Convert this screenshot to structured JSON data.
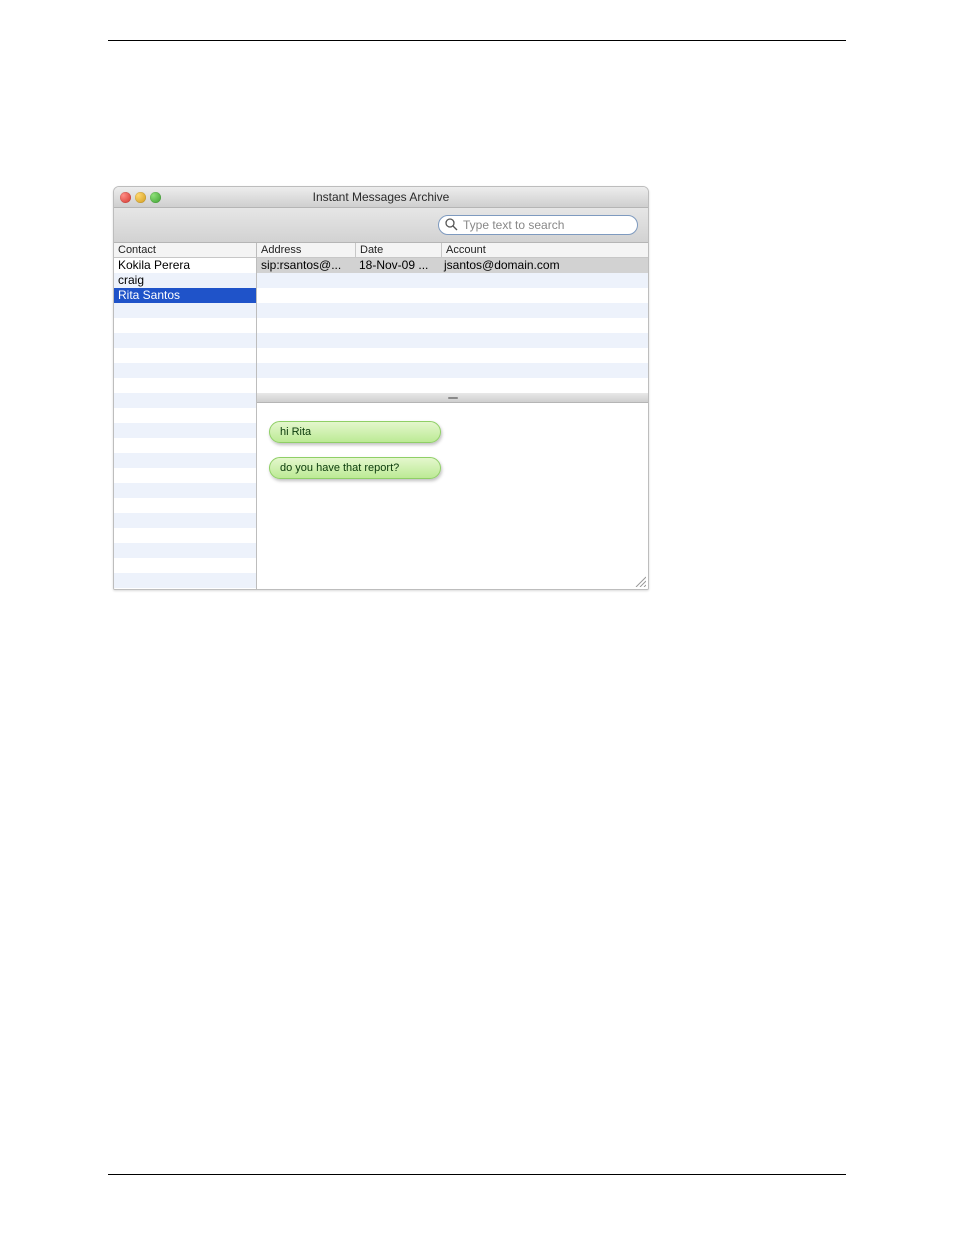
{
  "window": {
    "title": "Instant Messages Archive"
  },
  "search": {
    "placeholder": "Type text to search"
  },
  "contacts": {
    "header": "Contact",
    "items": [
      {
        "name": "Kokila Perera",
        "selected": false
      },
      {
        "name": "craig",
        "selected": false
      },
      {
        "name": "Rita Santos",
        "selected": true
      }
    ]
  },
  "sessions": {
    "headers": {
      "address": "Address",
      "date": "Date",
      "account": "Account"
    },
    "rows": [
      {
        "address": "sip:rsantos@...",
        "date": "18-Nov-09 ...",
        "account": "jsantos@domain.com",
        "selected": true
      }
    ]
  },
  "transcript": {
    "messages": [
      {
        "text": "hi Rita"
      },
      {
        "text": "do you have that report?"
      }
    ]
  }
}
